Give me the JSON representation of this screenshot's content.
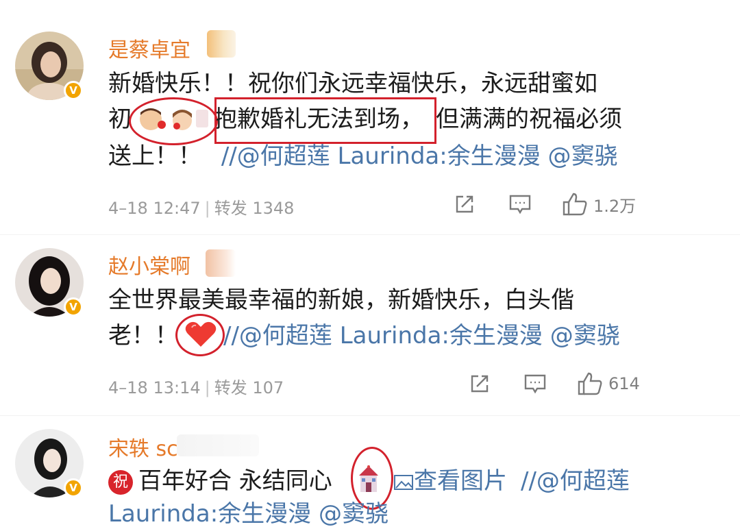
{
  "comments": [
    {
      "username": "是蔡卓宜",
      "lines": [
        "新婚快乐！！祝你们永远幸福快乐，永远甜蜜如",
        "初",
        "抱歉婚礼无法到场，",
        "但满满的祝福必须",
        "送上！！",
        "//@何超莲 Laurinda:余生漫漫 @窦骁"
      ],
      "time": "4–18 12:47",
      "forward_label": "转发",
      "forward_count": "1348",
      "likes": "1.2万"
    },
    {
      "username": "赵小棠啊",
      "lines": [
        "全世界最美最幸福的新娘，新婚快乐，白头偕",
        "老！！",
        "//@何超莲 Laurinda:余生漫漫 @窦骁"
      ],
      "time": "4–18 13:14",
      "forward_label": "转发",
      "forward_count": "107",
      "likes": "614"
    },
    {
      "username": "宋轶 sc",
      "lines": [
        "祝",
        "百年好合 永结同心",
        "查看图片",
        "//@何超莲",
        "Laurinda:余生漫漫 @窦骁"
      ]
    }
  ],
  "colors": {
    "username": "#e57a2a",
    "mention": "#4a76a8",
    "annotation": "#d3212c",
    "verified": "#f2a400"
  },
  "icons": [
    "verified-badge-icon",
    "share-icon",
    "comment-icon",
    "like-icon",
    "couple-emoji-icon",
    "heart-emoji-icon",
    "church-emoji-icon",
    "image-icon"
  ]
}
